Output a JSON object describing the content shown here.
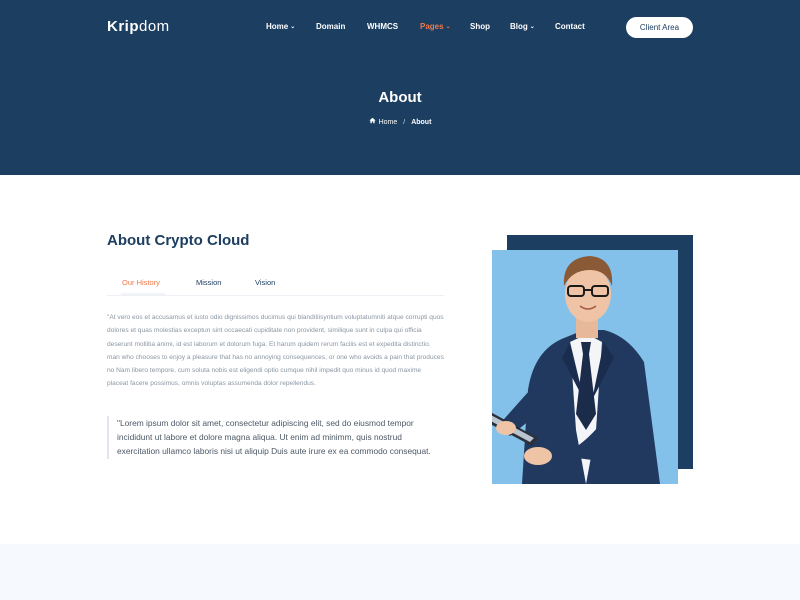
{
  "header": {
    "logo_bold": "Krip",
    "logo_rest": "dom",
    "nav": [
      {
        "label": "Home",
        "caret": "⌄"
      },
      {
        "label": "Domain"
      },
      {
        "label": "WHMCS"
      },
      {
        "label": "Pages",
        "caret": "⌄"
      },
      {
        "label": "Shop"
      },
      {
        "label": "Blog",
        "caret": "⌄"
      },
      {
        "label": "Contact"
      }
    ],
    "client_button": "Client Area"
  },
  "hero": {
    "title": "About",
    "breadcrumb": {
      "home_icon": "home-icon",
      "home": "Home",
      "separator": "/",
      "current": "About"
    }
  },
  "about": {
    "title": "About Crypto Cloud",
    "tabs": [
      "Our History",
      "Mission",
      "Vision"
    ],
    "active_tab": "Our History",
    "paragraph": "\"At vero eos et accusamus et iusto odio dignissimos ducimus qui blanditiisyntium voluptatumniti atque corrupti quos dolores et quas molestias exceptun sint occaecati cupiditate non provident, similique sunt in culpa qui officia deserunt mollitia animi, id est laborum et dolorum fuga. Et harum quidem rerum facilis est et expedita distinctio. man who chooses to enjoy a pleasure that has no annoying consequences, or one who avoids a pain that produces no Nam libero tempore, cum soluta nobis est eligendi optio cumque nihil impedit quo minus id quod maxime placeat facere possimus, omnis voluptas assumenda dolor repellendus.",
    "quote": "\"Lorem ipsum dolor sit amet, consectetur adipiscing elit, sed do eiusmod tempor incididunt ut labore et dolore magna aliqua. Ut enim ad minimm, quis nostrud exercitation ullamco laboris nisi ut aliquip Duis aute irure ex ea commodo consequat."
  },
  "colors": {
    "navy": "#1c3e60",
    "accent_orange": "#f2784b",
    "sky_blue": "#84c1ea"
  }
}
